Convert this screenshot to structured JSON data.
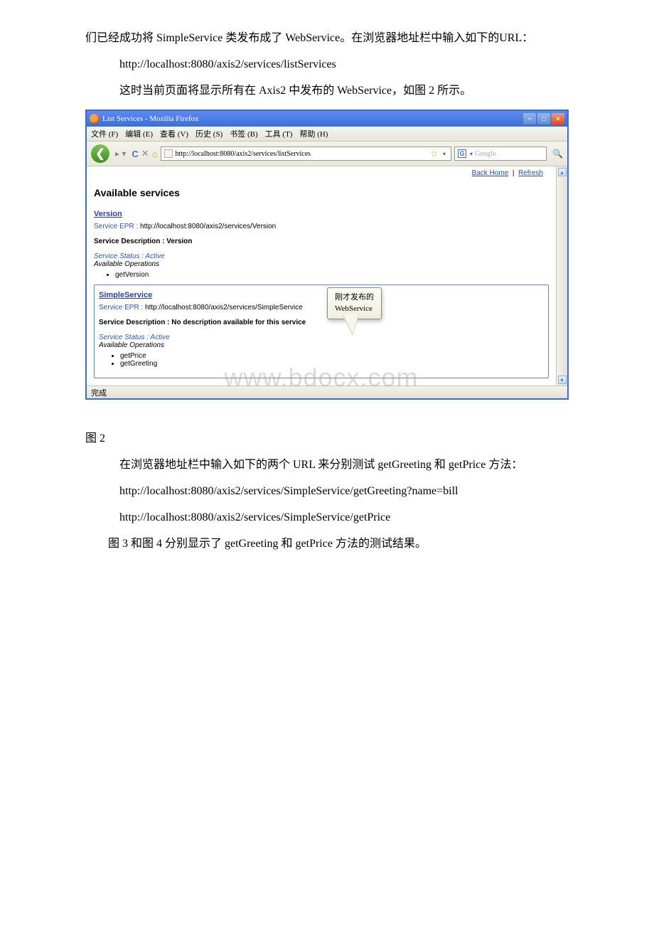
{
  "doc": {
    "para1": "们已经成功将 SimpleService 类发布成了 WebService。在浏览器地址栏中输入如下的URL：",
    "url1": "http://localhost:8080/axis2/services/listServices",
    "para2": "这时当前页面将显示所有在 Axis2 中发布的 WebService，如图 2 所示。",
    "fig2": "图 2",
    "para3": "在浏览器地址栏中输入如下的两个 URL 来分别测试 getGreeting 和 getPrice 方法：",
    "url2": "http://localhost:8080/axis2/services/SimpleService/getGreeting?name=bill",
    "url3": "http://localhost:8080/axis2/services/SimpleService/getPrice",
    "para4": "图 3 和图 4 分别显示了 getGreeting 和 getPrice 方法的测试结果。"
  },
  "browser": {
    "title": "List Services - Mozilla Firefox",
    "menus": {
      "file": "文件 (F)",
      "edit": "编辑 (E)",
      "view": "查看 (V)",
      "history": "历史 (S)",
      "bookmarks": "书签 (B)",
      "tools": "工具 (T)",
      "help": "帮助 (H)"
    },
    "address": "http://localhost:8080/axis2/services/listServices",
    "search_placeholder": "Google",
    "status": "完成",
    "back_home": "Back Home",
    "refresh": "Refresh",
    "page_heading": "Available services",
    "services": [
      {
        "name": "Version",
        "epr_label": "Service EPR :",
        "epr": "http://localhost:8080/axis2/services/Version",
        "desc_label": "Service Description : Version",
        "status_label": "Service Status : Active",
        "ops_label": "Available Operations",
        "ops": [
          "getVersion"
        ]
      },
      {
        "name": "SimpleService",
        "epr_label": "Service EPR :",
        "epr": "http://localhost:8080/axis2/services/SimpleService",
        "desc_label": "Service Description : No description available for this service",
        "status_label": "Service Status : Active",
        "ops_label": "Available Operations",
        "ops": [
          "getPrice",
          "getGreeting"
        ]
      }
    ],
    "callout_line1": "刚才发布的",
    "callout_line2": "WebService"
  },
  "watermark": "www.bdocx.com"
}
